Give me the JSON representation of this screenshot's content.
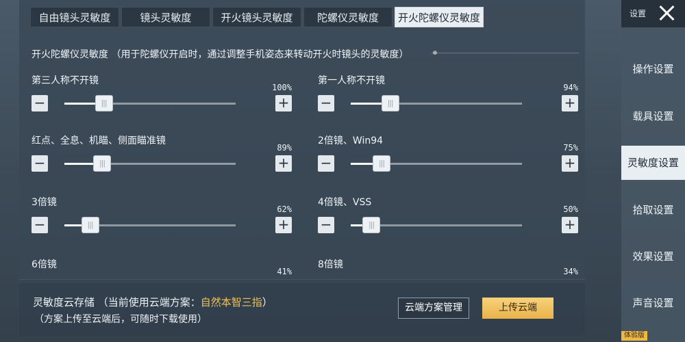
{
  "tabs": [
    {
      "label": "自由镜头灵敏度",
      "active": false
    },
    {
      "label": "镜头灵敏度",
      "active": false
    },
    {
      "label": "开火镜头灵敏度",
      "active": false
    },
    {
      "label": "陀螺仪灵敏度",
      "active": false
    },
    {
      "label": "开火陀螺仪灵敏度",
      "active": true
    }
  ],
  "section": {
    "title": "开火陀螺仪灵敏度 （用于陀螺仪开启时，通过调整手机姿态来转动开火时镜头的灵敏度）"
  },
  "settings": [
    {
      "label": "第三人称不开镜",
      "percent": "100%",
      "value": 0.23
    },
    {
      "label": "第一人称不开镜",
      "percent": "94%",
      "value": 0.23
    },
    {
      "label": "红点、全息、机瞄、侧面瞄准镜",
      "percent": "89%",
      "value": 0.22
    },
    {
      "label": "2倍镜、Win94",
      "percent": "75%",
      "value": 0.18
    },
    {
      "label": "3倍镜",
      "percent": "62%",
      "value": 0.15
    },
    {
      "label": "4倍镜、VSS",
      "percent": "50%",
      "value": 0.12
    },
    {
      "label": "6倍镜",
      "percent": "41%"
    },
    {
      "label": "8倍镜",
      "percent": "34%"
    }
  ],
  "controls": {
    "minus": "−",
    "plus": "+",
    "grip": "|||"
  },
  "cloud": {
    "title_prefix": "灵敏度云存储 （当前使用云端方案：",
    "scheme": "自然本智三指",
    "title_suffix": "）",
    "subtitle": "（方案上传至云端后，可随时下载使用）",
    "manage_label": "云端方案管理",
    "upload_label": "上传云端"
  },
  "sidebar": {
    "title": "设置",
    "items": [
      {
        "label": "操作设置",
        "active": false
      },
      {
        "label": "载具设置",
        "active": false
      },
      {
        "label": "灵敏度设置",
        "active": true
      },
      {
        "label": "拾取设置",
        "active": false
      },
      {
        "label": "效果设置",
        "active": false
      },
      {
        "label": "声音设置",
        "active": false
      }
    ]
  },
  "version_badge": "体验版",
  "colors": {
    "accent": "#f1c25a",
    "active_tab": "#e9eef2",
    "upload_button": "#eab34b"
  }
}
